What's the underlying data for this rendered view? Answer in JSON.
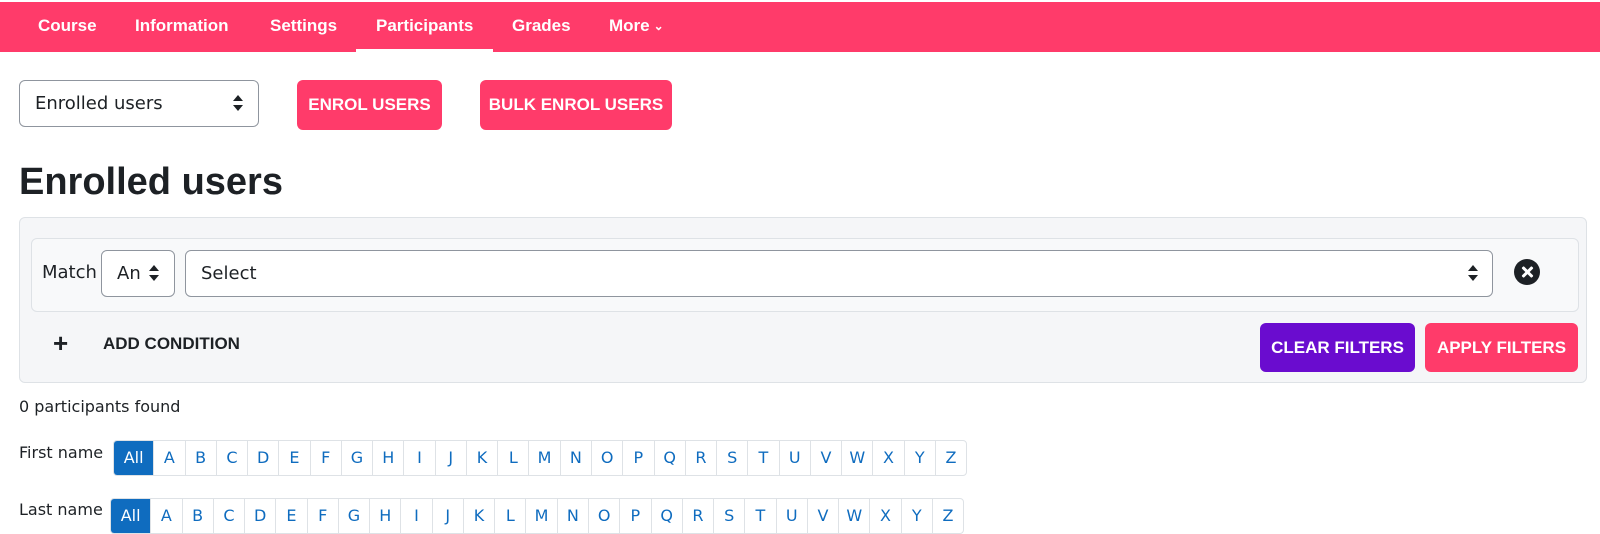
{
  "nav": {
    "items": [
      {
        "label": "Course"
      },
      {
        "label": "Information"
      },
      {
        "label": "Settings"
      },
      {
        "label": "Participants",
        "active": true
      },
      {
        "label": "Grades"
      },
      {
        "label": "More"
      }
    ],
    "more_chevron": "⌄"
  },
  "toolbar": {
    "view_select": "Enrolled users",
    "enrol_button": "ENROL USERS",
    "bulk_enrol_button": "BULK ENROL USERS"
  },
  "page": {
    "title": "Enrolled users"
  },
  "filters": {
    "match_label": "Match",
    "match_value": "An",
    "condition_select": "Select",
    "add_condition": "ADD CONDITION",
    "clear_button": "CLEAR FILTERS",
    "apply_button": "APPLY FILTERS"
  },
  "results": {
    "found_text": "0 participants found"
  },
  "initials": {
    "first_name_label": "First name",
    "last_name_label": "Last name",
    "letters": [
      "All",
      "A",
      "B",
      "C",
      "D",
      "E",
      "F",
      "G",
      "H",
      "I",
      "J",
      "K",
      "L",
      "M",
      "N",
      "O",
      "P",
      "Q",
      "R",
      "S",
      "T",
      "U",
      "V",
      "W",
      "X",
      "Y",
      "Z"
    ],
    "selected_first": "All",
    "selected_last": "All"
  },
  "colors": {
    "brand": "#ff3b6a",
    "secondary": "#6a0ccf",
    "link": "#0f6cbf"
  }
}
